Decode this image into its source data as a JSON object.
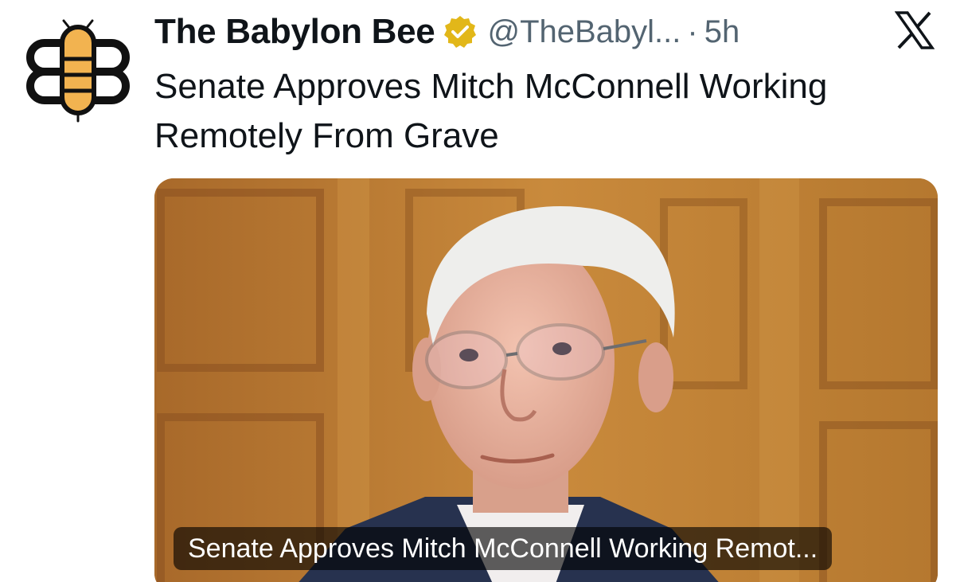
{
  "account": {
    "display_name": "The Babylon Bee",
    "handle": "@TheBabyl...",
    "separator": "·",
    "time_ago": "5h",
    "avatar_icon": "bee-logo-icon",
    "verified_icon": "verified-badge-icon",
    "brand_color": "#f2b350",
    "verified_color": "#e2b719"
  },
  "platform": {
    "logo_icon": "x-logo-icon"
  },
  "tweet": {
    "text": "Senate Approves Mitch McConnell Working Remotely From Grave"
  },
  "media": {
    "photo_icon": "article-photo",
    "caption": "Senate Approves Mitch McConnell Working Remot..."
  }
}
